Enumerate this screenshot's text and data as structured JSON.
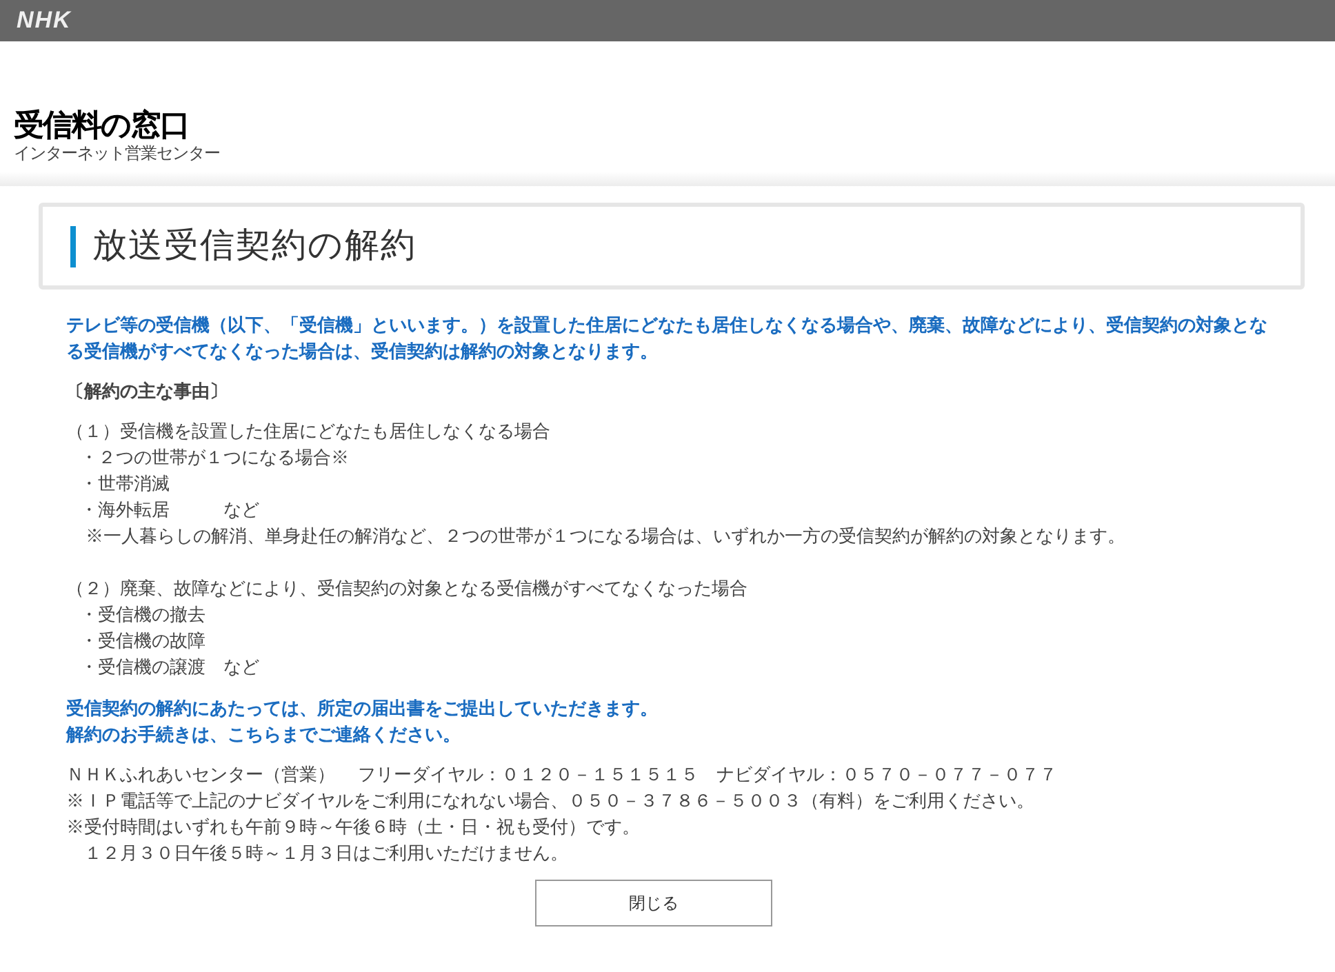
{
  "brand": "NHK",
  "header": {
    "title": "受信料の窓口",
    "subtitle": "インターネット営業センター"
  },
  "page_title": "放送受信契約の解約",
  "intro": "テレビ等の受信機（以下、「受信機」といいます。）を設置した住居にどなたも居住しなくなる場合や、廃棄、故障などにより、受信契約の対象となる受信機がすべてなくなった場合は、受信契約は解約の対象となります。",
  "reasons_heading": "〔解約の主な事由〕",
  "reason_groups": [
    {
      "heading": "（１）受信機を設置した住居にどなたも居住しなくなる場合",
      "items": [
        "・２つの世帯が１つになる場合※",
        "・世帯消滅",
        "・海外転居　　　など"
      ],
      "note": "※一人暮らしの解消、単身赴任の解消など、２つの世帯が１つになる場合は、いずれか一方の受信契約が解約の対象となります。"
    },
    {
      "heading": "（２）廃棄、故障などにより、受信契約の対象となる受信機がすべてなくなった場合",
      "items": [
        "・受信機の撤去",
        "・受信機の故障",
        "・受信機の譲渡　など"
      ]
    }
  ],
  "notice": [
    "受信契約の解約にあたっては、所定の届出書をご提出していただきます。",
    "解約のお手続きは、こちらまでご連絡ください。"
  ],
  "contact": [
    "ＮＨＫふれあいセンター（営業）　 フリーダイヤル：０１２０－１５１５１５　ナビダイヤル：０５７０－０７７－０７７",
    "※ＩＰ電話等で上記のナビダイヤルをご利用になれない場合、０５０－３７８６－５００３（有料）をご利用ください。",
    "※受付時間はいずれも午前９時～午後６時（土・日・祝も受付）です。",
    "　１２月３０日午後５時～１月３日はご利用いただけません。"
  ],
  "close_button": "閉じる"
}
